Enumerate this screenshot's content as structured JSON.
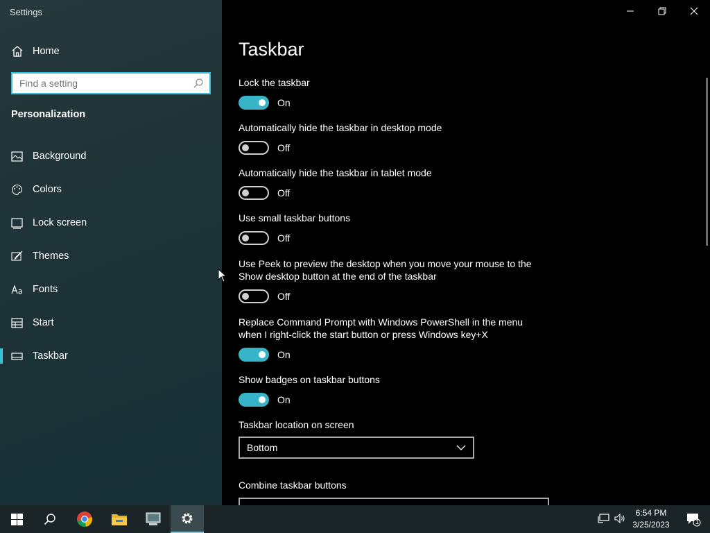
{
  "app": {
    "title": "Settings"
  },
  "sidebar": {
    "home_label": "Home",
    "search_placeholder": "Find a setting",
    "section_title": "Personalization",
    "items": [
      {
        "label": "Background",
        "icon": "picture-icon"
      },
      {
        "label": "Colors",
        "icon": "palette-icon"
      },
      {
        "label": "Lock screen",
        "icon": "lock-screen-icon"
      },
      {
        "label": "Themes",
        "icon": "brush-icon"
      },
      {
        "label": "Fonts",
        "icon": "font-icon"
      },
      {
        "label": "Start",
        "icon": "start-layout-icon"
      },
      {
        "label": "Taskbar",
        "icon": "taskbar-icon",
        "selected": true
      }
    ]
  },
  "main": {
    "title": "Taskbar",
    "settings": [
      {
        "label": "Lock the taskbar",
        "state": "On",
        "on": true
      },
      {
        "label": "Automatically hide the taskbar in desktop mode",
        "state": "Off",
        "on": false
      },
      {
        "label": "Automatically hide the taskbar in tablet mode",
        "state": "Off",
        "on": false
      },
      {
        "label": "Use small taskbar buttons",
        "state": "Off",
        "on": false
      },
      {
        "label": "Use Peek to preview the desktop when you move your mouse to the Show desktop button at the end of the taskbar",
        "state": "Off",
        "on": false
      },
      {
        "label": "Replace Command Prompt with Windows PowerShell in the menu when I right-click the start button or press Windows key+X",
        "state": "On",
        "on": true
      },
      {
        "label": "Show badges on taskbar buttons",
        "state": "On",
        "on": true
      }
    ],
    "location_label": "Taskbar location on screen",
    "location_value": "Bottom",
    "combine_label": "Combine taskbar buttons"
  },
  "taskbar": {
    "time": "6:54 PM",
    "date": "3/25/2023",
    "notification_count": "1"
  },
  "colors": {
    "accent": "#37b4c8",
    "sidebar_bg": "#1e3337",
    "taskbar_bg": "#1b2528"
  }
}
